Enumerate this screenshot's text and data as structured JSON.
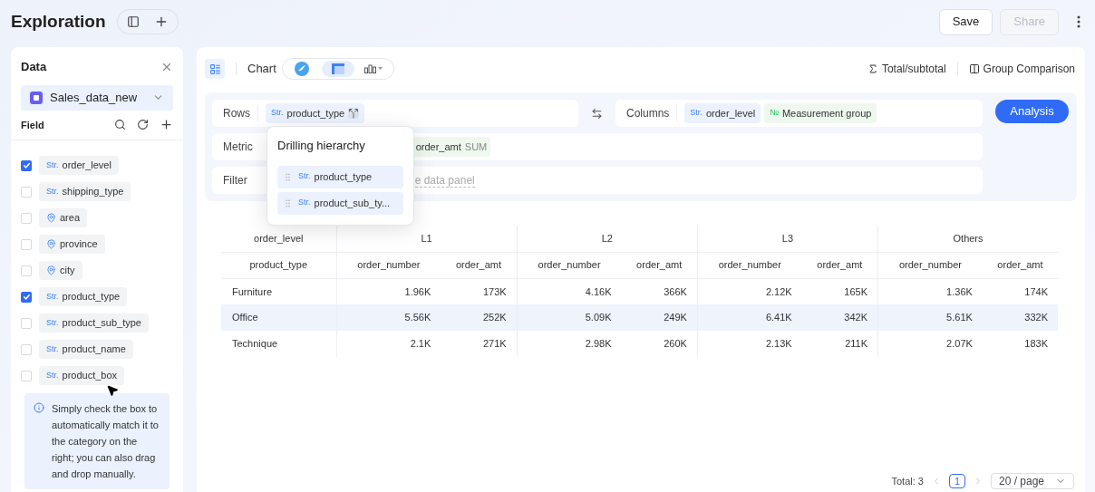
{
  "header": {
    "title": "Exploration",
    "buttons": [
      {
        "label": "Save",
        "disabled": false
      },
      {
        "label": "Share",
        "disabled": true
      }
    ]
  },
  "data_panel": {
    "title": "Data",
    "dataset": "Sales_data_new",
    "field_heading": "Field",
    "fields": [
      {
        "kind": "str",
        "type": "Str.",
        "name": "order_level",
        "checked": true
      },
      {
        "kind": "str",
        "type": "Str.",
        "name": "shipping_type",
        "checked": false
      },
      {
        "kind": "geo",
        "name": "area",
        "checked": false
      },
      {
        "kind": "geo",
        "name": "province",
        "checked": false
      },
      {
        "kind": "geo",
        "name": "city",
        "checked": false
      },
      {
        "kind": "str",
        "type": "Str.",
        "name": "product_type",
        "checked": true
      },
      {
        "kind": "str",
        "type": "Str.",
        "name": "product_sub_type",
        "checked": false
      },
      {
        "kind": "str",
        "type": "Str.",
        "name": "product_name",
        "checked": false
      },
      {
        "kind": "str",
        "type": "Str.",
        "name": "product_box",
        "checked": false
      }
    ],
    "tip": "Simply check the box to automatically match it to the category on the right; you can also drag and drop manually."
  },
  "toolbar": {
    "chart_label": "Chart",
    "chart_types": [
      {
        "kind": "logo",
        "selected": false
      },
      {
        "kind": "table",
        "selected": true
      },
      {
        "kind": "bar",
        "selected": false
      }
    ],
    "actions": [
      {
        "kind": "sum",
        "label": "Total/subtotal"
      },
      {
        "kind": "compare",
        "label": "Group Comparison"
      }
    ]
  },
  "config": {
    "rows": {
      "label": "Rows",
      "chips": [
        {
          "kind": "dimension",
          "type": "Str.",
          "name": "product_type"
        }
      ]
    },
    "columns": {
      "label": "Columns",
      "chips": [
        {
          "kind": "dimension",
          "type": "Str.",
          "name": "order_level"
        },
        {
          "kind": "measure",
          "type": "№",
          "name": "Measurement group"
        }
      ]
    },
    "metric": {
      "label": "Metric",
      "chip_text": "order_amt",
      "aggregation": "SUM"
    },
    "filter": {
      "label": "Filter",
      "hint": "e data panel"
    },
    "analysis_button": "Analysis"
  },
  "drill_popover": {
    "title": "Drilling hierarchy",
    "items": [
      {
        "type": "Str.",
        "name": "product_type"
      },
      {
        "type": "Str.",
        "name": "product_sub_ty..."
      }
    ]
  },
  "table": {
    "corner": [
      "order_level",
      "product_type"
    ],
    "groups": [
      {
        "label": "L1",
        "columns": [
          "order_number",
          "order_amt"
        ]
      },
      {
        "label": "L2",
        "columns": [
          "order_number",
          "order_amt"
        ]
      },
      {
        "label": "L3",
        "columns": [
          "order_number",
          "order_amt"
        ]
      },
      {
        "label": "Others",
        "columns": [
          "order_number",
          "order_amt"
        ]
      }
    ],
    "rows": [
      {
        "label": "Furniture",
        "highlighted": false,
        "values": [
          "1.96K",
          "173K",
          "4.16K",
          "366K",
          "2.12K",
          "165K",
          "1.36K",
          "174K"
        ]
      },
      {
        "label": "Office",
        "highlighted": true,
        "values": [
          "5.56K",
          "252K",
          "5.09K",
          "249K",
          "6.41K",
          "342K",
          "5.61K",
          "332K"
        ]
      },
      {
        "label": "Technique",
        "highlighted": false,
        "values": [
          "2.1K",
          "271K",
          "2.98K",
          "260K",
          "2.13K",
          "211K",
          "2.07K",
          "183K"
        ]
      }
    ]
  },
  "pagination": {
    "total": "Total: 3",
    "pages": [
      {
        "label": "1",
        "selected": true
      }
    ],
    "page_size": "20 / page"
  }
}
